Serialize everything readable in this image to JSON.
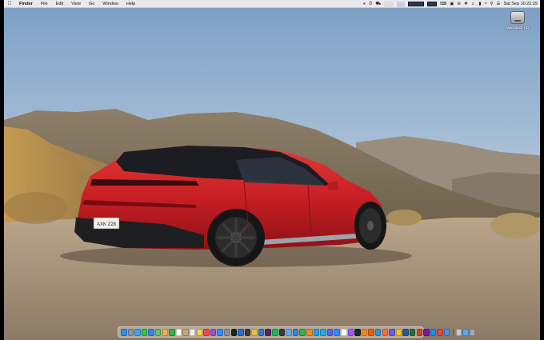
{
  "menubar": {
    "apple_icon": "apple-icon",
    "menus": [
      "Finder",
      "File",
      "Edit",
      "View",
      "Go",
      "Window",
      "Help"
    ],
    "status_icons": [
      "red-dot-icon",
      "stopwatch-icon",
      "car-icon",
      "cpu-stats-icon",
      "graph-icon",
      "display-icon",
      "bars-icon",
      "keyboard-icon",
      "lock-icon",
      "bluetooth-icon",
      "dropbox-icon",
      "volume-icon",
      "battery-icon",
      "wifi-icon",
      "search-icon",
      "control-center-icon"
    ],
    "clock": "Sat Sep 10  22:29"
  },
  "desktop": {
    "drive_icon": "hard-drive-icon",
    "drive_label": "Macintosh HD"
  },
  "dock": {
    "apps": [
      {
        "name": "finder-icon",
        "color": "#2d8ff0"
      },
      {
        "name": "launchpad-icon",
        "color": "#8a94a6"
      },
      {
        "name": "safari-icon",
        "color": "#3ba3f5"
      },
      {
        "name": "messages-icon",
        "color": "#36c24a"
      },
      {
        "name": "mail-icon",
        "color": "#3b82f0"
      },
      {
        "name": "maps-icon",
        "color": "#5ac46a"
      },
      {
        "name": "photos-icon",
        "color": "#f3b23a"
      },
      {
        "name": "facetime-icon",
        "color": "#31b24a"
      },
      {
        "name": "calendar-icon",
        "color": "#ffffff"
      },
      {
        "name": "contacts-icon",
        "color": "#c9a77a"
      },
      {
        "name": "reminders-icon",
        "color": "#f2f2f2"
      },
      {
        "name": "notes-icon",
        "color": "#f7d54a"
      },
      {
        "name": "music-icon",
        "color": "#f0455a"
      },
      {
        "name": "podcasts-icon",
        "color": "#9b4ed6"
      },
      {
        "name": "appstore-icon",
        "color": "#2f8cf4"
      },
      {
        "name": "settings-icon",
        "color": "#8e8e93"
      },
      {
        "name": "terminal-icon",
        "color": "#222222"
      },
      {
        "name": "xcode-icon",
        "color": "#1e6fd9"
      },
      {
        "name": "activity-icon",
        "color": "#3c3c3c"
      },
      {
        "name": "chrome-icon",
        "color": "#e8c03a"
      },
      {
        "name": "vscode-icon",
        "color": "#2a7bd1"
      },
      {
        "name": "slack-icon",
        "color": "#611f69"
      },
      {
        "name": "spotify-icon",
        "color": "#1db954"
      },
      {
        "name": "github-icon",
        "color": "#3a3a3a"
      },
      {
        "name": "preview-icon",
        "color": "#6aa7e8"
      },
      {
        "name": "keynote-icon",
        "color": "#2a86e0"
      },
      {
        "name": "numbers-icon",
        "color": "#33b04c"
      },
      {
        "name": "pages-icon",
        "color": "#f08a24"
      },
      {
        "name": "twitter-icon",
        "color": "#1da1f2"
      },
      {
        "name": "telegram-icon",
        "color": "#2ca5e0"
      },
      {
        "name": "discord-icon",
        "color": "#5865f2"
      },
      {
        "name": "zoom-icon",
        "color": "#2d8cff"
      },
      {
        "name": "notion-icon",
        "color": "#ffffff"
      },
      {
        "name": "figma-icon",
        "color": "#a259ff"
      },
      {
        "name": "steam-icon",
        "color": "#1b2838"
      },
      {
        "name": "vlc-icon",
        "color": "#f28c28"
      },
      {
        "name": "firefox-icon",
        "color": "#e66000"
      },
      {
        "name": "docker-icon",
        "color": "#2496ed"
      },
      {
        "name": "postman-icon",
        "color": "#ff6c37"
      },
      {
        "name": "iina-icon",
        "color": "#6c5ce7"
      },
      {
        "name": "transmit-icon",
        "color": "#f0c419"
      },
      {
        "name": "word-icon",
        "color": "#2b579a"
      },
      {
        "name": "excel-icon",
        "color": "#217346"
      },
      {
        "name": "powerpoint-icon",
        "color": "#d24726"
      },
      {
        "name": "onenote-icon",
        "color": "#7719aa"
      },
      {
        "name": "1password-icon",
        "color": "#1a8cff"
      },
      {
        "name": "bear-icon",
        "color": "#d94b3f"
      },
      {
        "name": "things-icon",
        "color": "#4a90e2"
      }
    ],
    "trailing": [
      {
        "name": "downloads-icon",
        "color": "#c8c8cc"
      },
      {
        "name": "folder-icon",
        "color": "#5aa9f0"
      },
      {
        "name": "trash-icon",
        "color": "#a9a9ae"
      }
    ]
  },
  "wallpaper": {
    "subject": "red-car-wallpaper",
    "car_color": "#c71f24",
    "plate_text": "AXK Z28"
  }
}
